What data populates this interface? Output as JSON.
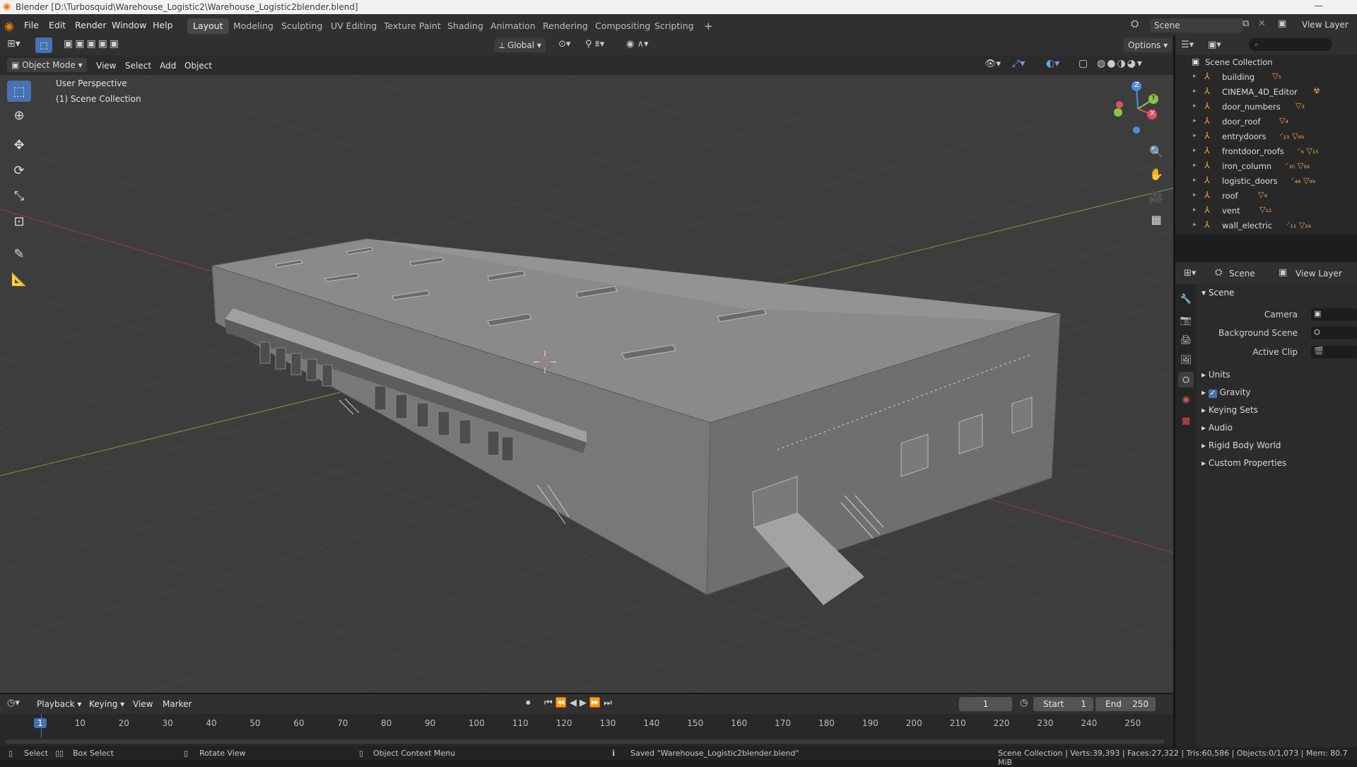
{
  "window": {
    "title": "Blender [D:\\Turbosquid\\Warehouse_Logistic2\\Warehouse_Logistic2blender.blend]"
  },
  "menu": {
    "items": [
      "File",
      "Edit",
      "Render",
      "Window",
      "Help"
    ]
  },
  "workspaces": {
    "tabs": [
      "Layout",
      "Modeling",
      "Sculpting",
      "UV Editing",
      "Texture Paint",
      "Shading",
      "Animation",
      "Rendering",
      "Compositing",
      "Scripting"
    ],
    "active": "Layout",
    "add": "+"
  },
  "scene_selector": {
    "scene": "Scene",
    "view_layer": "View Layer"
  },
  "tool_header": {
    "orientation": "Global",
    "options": "Options"
  },
  "view_header": {
    "mode": "Object Mode",
    "menus": [
      "View",
      "Select",
      "Add",
      "Object"
    ]
  },
  "viewport": {
    "perspective": "User Perspective",
    "collection": "(1) Scene Collection"
  },
  "gizmo": {
    "x": "X",
    "y": "Y",
    "z": "Z"
  },
  "outliner": {
    "root": "Scene Collection",
    "items": [
      {
        "name": "building",
        "extra": "▽₅"
      },
      {
        "name": "CINEMA_4D_Editor",
        "extra": "☢"
      },
      {
        "name": "door_numbers",
        "extra": "▽₃"
      },
      {
        "name": "door_roof",
        "extra": "▽₄"
      },
      {
        "name": "entrydoors",
        "extra": "⸍₂₃ ▽₉₉"
      },
      {
        "name": "frontdoor_roofs",
        "extra": "⸍₆ ▽₁₅"
      },
      {
        "name": "iron_column",
        "extra": "⸍₃₀ ▽₉₉"
      },
      {
        "name": "logistic_doors",
        "extra": "⸍₄₈ ▽₉₉"
      },
      {
        "name": "roof",
        "extra": "▽₄"
      },
      {
        "name": "vent",
        "extra": "▽₁₂"
      },
      {
        "name": "wall_electric",
        "extra": "⸍₁₁ ▽₂₄"
      }
    ]
  },
  "properties": {
    "header_scene": "Scene",
    "header_view_layer": "View Layer",
    "panel": "Scene",
    "camera_label": "Camera",
    "background_label": "Background Scene",
    "clip_label": "Active Clip",
    "sections": [
      "Units",
      "Gravity",
      "Keying Sets",
      "Audio",
      "Rigid Body World",
      "Custom Properties"
    ],
    "gravity_checked": true
  },
  "timeline": {
    "menus": [
      "Playback",
      "Keying",
      "View",
      "Marker"
    ],
    "current_frame": "1",
    "start_label": "Start",
    "start": "1",
    "end_label": "End",
    "end": "250",
    "ticks": [
      "1",
      "10",
      "20",
      "30",
      "40",
      "50",
      "60",
      "70",
      "80",
      "90",
      "100",
      "110",
      "120",
      "130",
      "140",
      "150",
      "160",
      "170",
      "180",
      "190",
      "200",
      "210",
      "220",
      "230",
      "240",
      "250"
    ]
  },
  "status": {
    "select": "Select",
    "box_select": "Box Select",
    "rotate": "Rotate View",
    "context": "Object Context Menu",
    "saved": "Saved \"Warehouse_Logistic2blender.blend\"",
    "stats": "Scene Collection | Verts:39,393 | Faces:27,322 | Tris:60,586 | Objects:0/1,073 | Mem: 80.7 MiB"
  }
}
